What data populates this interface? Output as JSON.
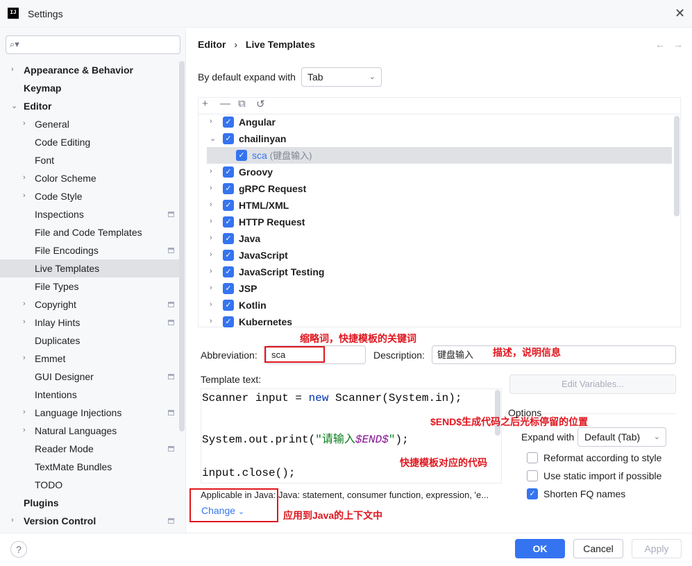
{
  "window": {
    "title": "Settings",
    "app_icon": "IJ"
  },
  "search": {
    "placeholder": ""
  },
  "sidebar": {
    "items": [
      {
        "label": "Appearance & Behavior",
        "level": 0,
        "bold": true,
        "expandable": true,
        "expanded": false
      },
      {
        "label": "Keymap",
        "level": 0,
        "bold": true
      },
      {
        "label": "Editor",
        "level": 0,
        "bold": true,
        "expandable": true,
        "expanded": true
      },
      {
        "label": "General",
        "level": 1,
        "expandable": true
      },
      {
        "label": "Code Editing",
        "level": 1
      },
      {
        "label": "Font",
        "level": 1
      },
      {
        "label": "Color Scheme",
        "level": 1,
        "expandable": true
      },
      {
        "label": "Code Style",
        "level": 1,
        "expandable": true
      },
      {
        "label": "Inspections",
        "level": 1,
        "project_icon": true
      },
      {
        "label": "File and Code Templates",
        "level": 1
      },
      {
        "label": "File Encodings",
        "level": 1,
        "project_icon": true
      },
      {
        "label": "Live Templates",
        "level": 1,
        "selected": true
      },
      {
        "label": "File Types",
        "level": 1
      },
      {
        "label": "Copyright",
        "level": 1,
        "expandable": true,
        "project_icon": true
      },
      {
        "label": "Inlay Hints",
        "level": 1,
        "expandable": true,
        "project_icon": true
      },
      {
        "label": "Duplicates",
        "level": 1
      },
      {
        "label": "Emmet",
        "level": 1,
        "expandable": true
      },
      {
        "label": "GUI Designer",
        "level": 1,
        "project_icon": true
      },
      {
        "label": "Intentions",
        "level": 1
      },
      {
        "label": "Language Injections",
        "level": 1,
        "expandable": true,
        "project_icon": true
      },
      {
        "label": "Natural Languages",
        "level": 1,
        "expandable": true
      },
      {
        "label": "Reader Mode",
        "level": 1,
        "project_icon": true
      },
      {
        "label": "TextMate Bundles",
        "level": 1
      },
      {
        "label": "TODO",
        "level": 1
      },
      {
        "label": "Plugins",
        "level": 0,
        "bold": true
      },
      {
        "label": "Version Control",
        "level": 0,
        "bold": true,
        "expandable": true,
        "project_icon": true
      }
    ]
  },
  "breadcrumb": {
    "parent": "Editor",
    "separator": "›",
    "current": "Live Templates"
  },
  "nav": {
    "back": "←",
    "forward": "→"
  },
  "expand": {
    "label": "By default expand with",
    "value": "Tab"
  },
  "toolbar": {
    "add": "+",
    "remove": "—",
    "copy": "⧉",
    "revert": "↺"
  },
  "templates": [
    {
      "name": "Angular",
      "checked": true,
      "expanded": false,
      "level": 0
    },
    {
      "name": "chailinyan",
      "checked": true,
      "expanded": true,
      "level": 0
    },
    {
      "name": "sca",
      "desc": "(键盘输入)",
      "checked": true,
      "level": 1,
      "selected": true
    },
    {
      "name": "Groovy",
      "checked": true,
      "expanded": false,
      "level": 0
    },
    {
      "name": "gRPC Request",
      "checked": true,
      "expanded": false,
      "level": 0
    },
    {
      "name": "HTML/XML",
      "checked": true,
      "expanded": false,
      "level": 0
    },
    {
      "name": "HTTP Request",
      "checked": true,
      "expanded": false,
      "level": 0
    },
    {
      "name": "Java",
      "checked": true,
      "expanded": false,
      "level": 0
    },
    {
      "name": "JavaScript",
      "checked": true,
      "expanded": false,
      "level": 0
    },
    {
      "name": "JavaScript Testing",
      "checked": true,
      "expanded": false,
      "level": 0
    },
    {
      "name": "JSP",
      "checked": true,
      "expanded": false,
      "level": 0
    },
    {
      "name": "Kotlin",
      "checked": true,
      "expanded": false,
      "level": 0
    },
    {
      "name": "Kubernetes",
      "checked": true,
      "expanded": false,
      "level": 0
    }
  ],
  "form": {
    "abbreviation_label": "Abbreviation:",
    "abbreviation_value": "sca",
    "description_label": "Description:",
    "description_value": "键盘输入",
    "template_text_label": "Template text:",
    "edit_variables": "Edit Variables...",
    "code": {
      "line1_a": "Scanner input = ",
      "line1_kw": "new",
      "line1_b": " Scanner(System.in);",
      "line2_a": "System.out.print(",
      "line2_str": "\"请输入",
      "line2_var": "$END$",
      "line2_str2": "\"",
      "line2_b": ");",
      "line3": "input.close();"
    },
    "applicable_label": "Applicable in Java: Java: statement, consumer function, expression, 'e...",
    "change_link": "Change",
    "change_chevron": "⌄"
  },
  "options": {
    "title": "Options",
    "expand_with_label": "Expand with",
    "expand_with_value": "Default (Tab)",
    "reformat": {
      "label": "Reformat according to style",
      "checked": false
    },
    "static_import": {
      "label": "Use static import if possible",
      "checked": false
    },
    "shorten_fq": {
      "label": "Shorten FQ names",
      "checked": true
    }
  },
  "annotations": {
    "abbreviation_note": "缩略词，快捷模板的关键词",
    "description_note": "描述，说明信息",
    "end_note": "$END$生成代码之后光标停留的位置",
    "code_note": "快捷模板对应的代码",
    "context_note": "应用到Java的上下文中"
  },
  "footer": {
    "help": "?",
    "ok": "OK",
    "cancel": "Cancel",
    "apply": "Apply"
  },
  "colors": {
    "accent": "#3574f0",
    "annotation": "#e0161e",
    "selection": "#dfe1e5"
  }
}
